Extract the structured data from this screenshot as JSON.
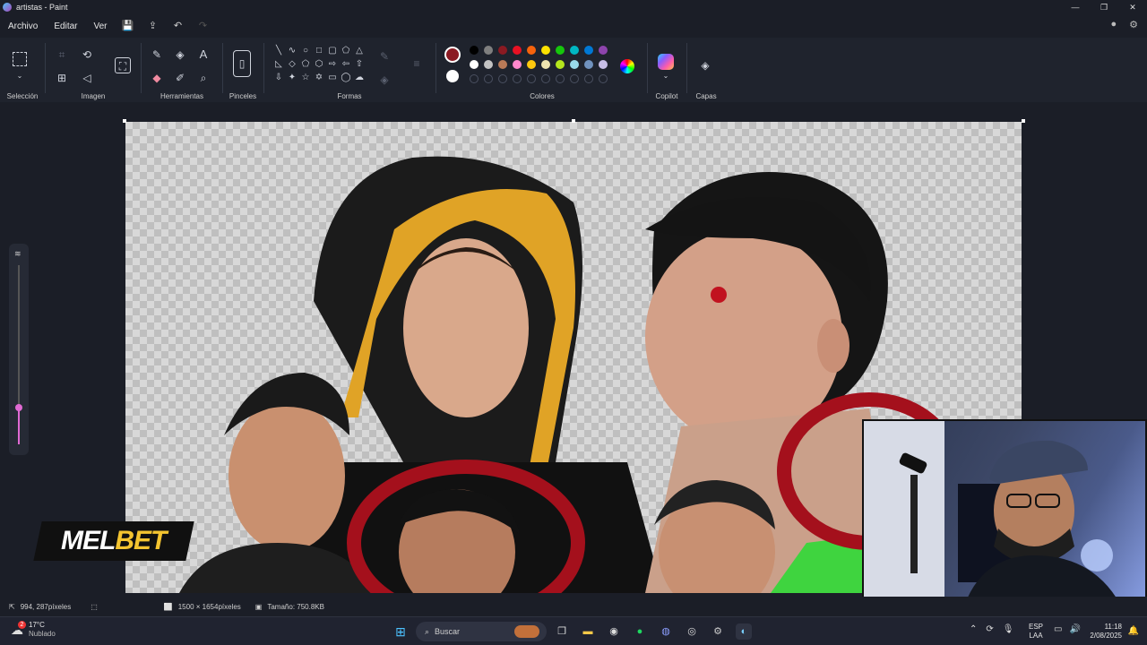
{
  "window": {
    "title": "artistas - Paint",
    "minimize": "—",
    "maximize": "❐",
    "close": "✕"
  },
  "menu": {
    "items": [
      "Archivo",
      "Editar",
      "Ver"
    ]
  },
  "ribbon": {
    "groups": {
      "seleccion": "Selección",
      "imagen": "Imagen",
      "herramientas": "Herramientas",
      "pinceles": "Pinceles",
      "formas": "Formas",
      "colores": "Colores",
      "copilot": "Copilot",
      "capas": "Capas"
    },
    "primary_color": "#8b1a22",
    "secondary_color": "#ffffff",
    "palette_row1": [
      "#000000",
      "#7f7f7f",
      "#8b1a22",
      "#e81123",
      "#f7630c",
      "#fce100",
      "#16c60c",
      "#00b7c3",
      "#0078d4",
      "#8e44ad"
    ],
    "palette_row2": [
      "#ffffff",
      "#c3c3c3",
      "#b97a57",
      "#ff88cc",
      "#ffc90e",
      "#efe4b0",
      "#b5e61d",
      "#99d9ea",
      "#7092be",
      "#c8bfe7"
    ]
  },
  "overlay": {
    "melbet_mel": "MEL",
    "melbet_bet": "BET"
  },
  "status": {
    "cursor_pos": "994, 287píxeles",
    "image_size": "1500 × 1654píxeles",
    "file_size": "Tamaño: 750.8KB"
  },
  "taskbar": {
    "weather_temp": "17°C",
    "weather_desc": "Nublado",
    "weather_badge": "2",
    "search_placeholder": "Buscar",
    "lang1": "ESP",
    "lang2": "LAA",
    "time": "11:18",
    "date": "2/08/2025"
  }
}
